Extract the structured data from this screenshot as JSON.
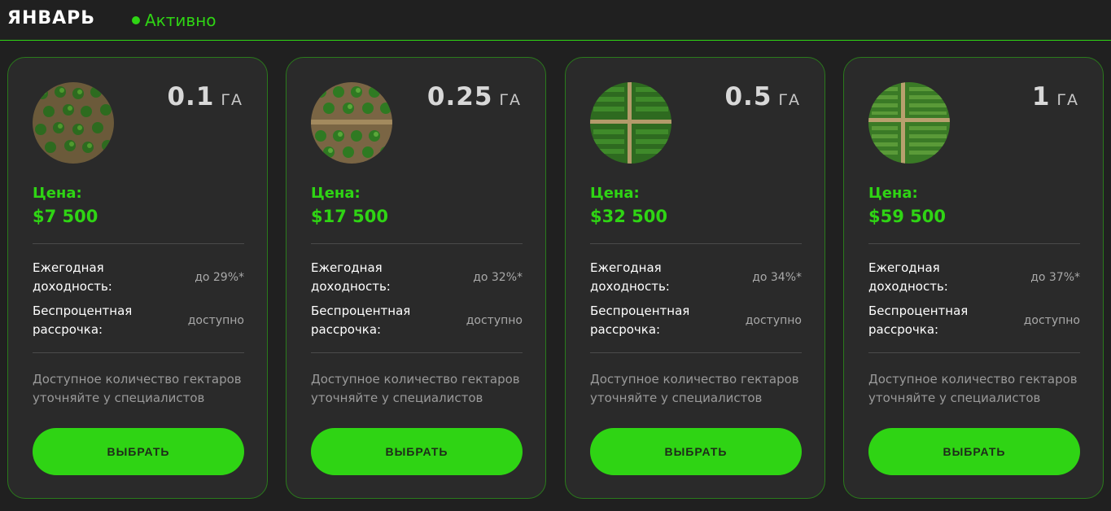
{
  "header": {
    "title": "ЯНВАРЬ",
    "status": "Активно",
    "accent_color": "#2fd414"
  },
  "plans": [
    {
      "area": "0.1",
      "unit": "ГА",
      "price_label": "Цена:",
      "price": "$7 500",
      "yield_label": "Ежегодная доходность:",
      "yield_value": "до 29%*",
      "installment_label": "Беспроцентная рассрочка:",
      "installment_value": "доступно",
      "note": "Доступное количество гектаров уточняйте у специалистов",
      "button": "ВЫБРАТЬ",
      "image_icon": "tree-plantation-aerial-photo"
    },
    {
      "area": "0.25",
      "unit": "ГА",
      "price_label": "Цена:",
      "price": "$17 500",
      "yield_label": "Ежегодная доходность:",
      "yield_value": "до 32%*",
      "installment_label": "Беспроцентная рассрочка:",
      "installment_value": "доступно",
      "note": "Доступное количество гектаров уточняйте у специалистов",
      "button": "ВЫБРАТЬ",
      "image_icon": "tree-plantation-aerial-photo"
    },
    {
      "area": "0.5",
      "unit": "ГА",
      "price_label": "Цена:",
      "price": "$32 500",
      "yield_label": "Ежегодная доходность:",
      "yield_value": "до 34%*",
      "installment_label": "Беспроцентная рассрочка:",
      "installment_value": "доступно",
      "note": "Доступное количество гектаров уточняйте у специалистов",
      "button": "ВЫБРАТЬ",
      "image_icon": "tree-plantation-aerial-photo"
    },
    {
      "area": "1",
      "unit": "ГА",
      "price_label": "Цена:",
      "price": "$59 500",
      "yield_label": "Ежегодная доходность:",
      "yield_value": "до 37%*",
      "installment_label": "Беспроцентная рассрочка:",
      "installment_value": "доступно",
      "note": "Доступное количество гектаров уточняйте у специалистов",
      "button": "ВЫБРАТЬ",
      "image_icon": "tree-plantation-aerial-photo"
    }
  ]
}
